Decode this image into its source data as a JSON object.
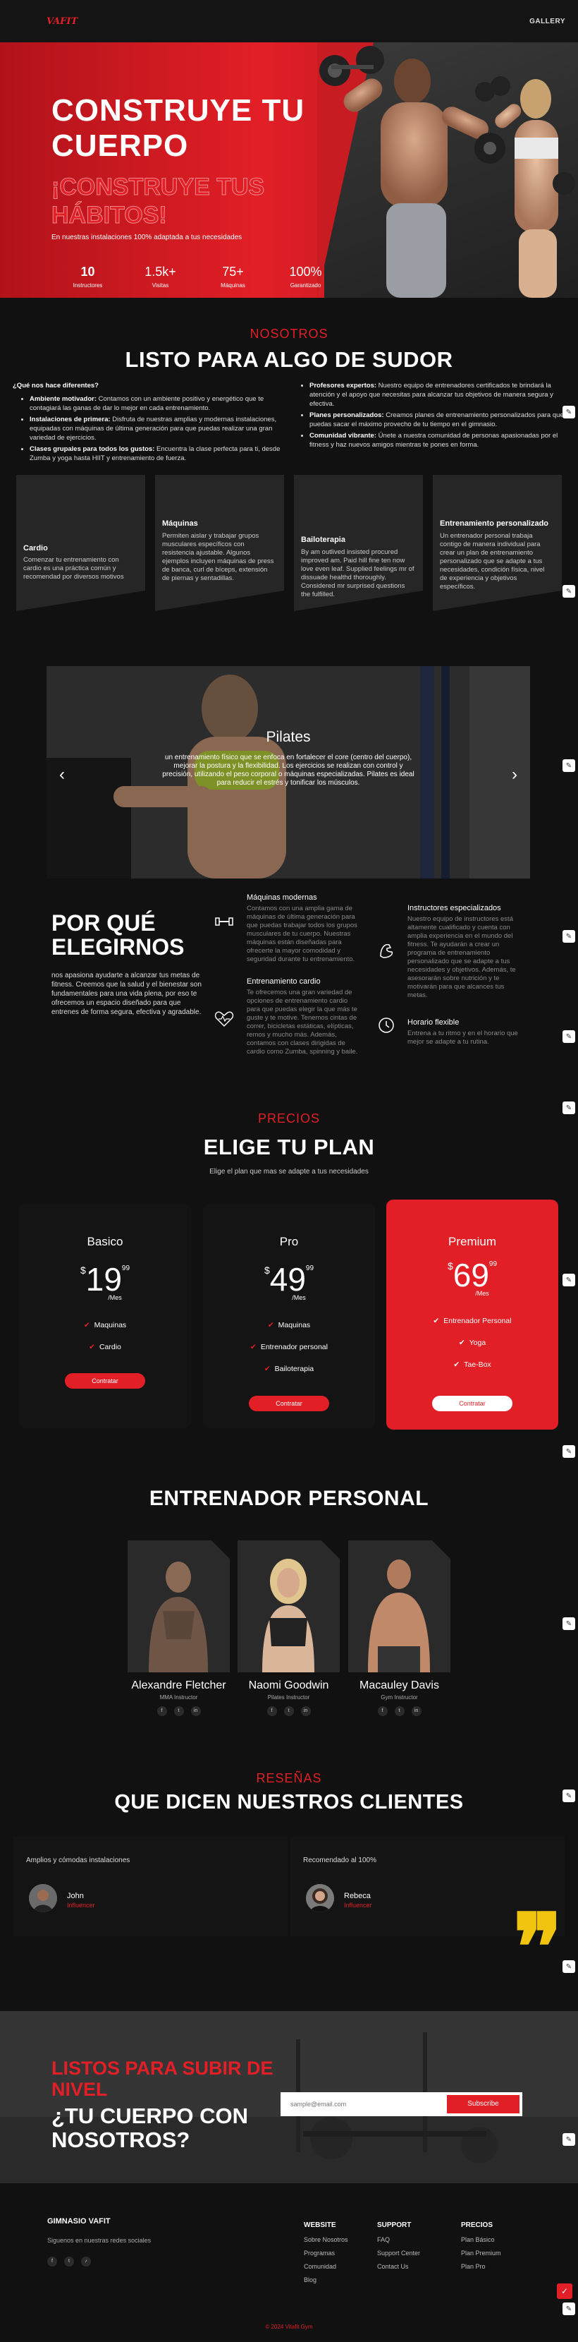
{
  "header": {
    "logo": "VAFIT",
    "nav_gallery": "GALLERY"
  },
  "hero": {
    "title": "CONSTRUYE TU CUERPO",
    "subtitle": "¡CONSTRUYE TUS HÁBITOS!",
    "description": "En nuestras instalaciones 100% adaptada a tus necesidades",
    "stats": [
      {
        "value": "10",
        "label": "Instructores"
      },
      {
        "value": "1.5k+",
        "label": "Visitas"
      },
      {
        "value": "75+",
        "label": "Máquinas"
      },
      {
        "value": "100%",
        "label": "Garantizado"
      }
    ]
  },
  "about": {
    "kicker": "NOSOTROS",
    "heading": "LISTO PARA ALGO DE SUDOR",
    "question": "¿Qué nos hace diferentes?",
    "left_items": [
      {
        "bold": "Ambiente motivador:",
        "text": " Contamos con un ambiente positivo y energético que te contagiará las ganas de dar lo mejor en cada entrenamiento."
      },
      {
        "bold": "Instalaciones de primera:",
        "text": " Disfruta de nuestras amplias y modernas instalaciones, equipadas con máquinas de última generación para que puedas realizar una gran variedad de ejercicios."
      },
      {
        "bold": "Clases grupales para todos los gustos:",
        "text": " Encuentra la clase perfecta para ti, desde Zumba y yoga hasta HIIT y entrenamiento de fuerza."
      }
    ],
    "right_items": [
      {
        "bold": "Profesores expertos:",
        "text": " Nuestro equipo de entrenadores certificados te brindará la atención y el apoyo que necesitas para alcanzar tus objetivos de manera segura y efectiva."
      },
      {
        "bold": "Planes personalizados:",
        "text": " Creamos planes de entrenamiento personalizados para que puedas sacar el máximo provecho de tu tiempo en el gimnasio."
      },
      {
        "bold": "Comunidad vibrante:",
        "text": " Únete a nuestra comunidad de personas apasionadas por el fitness y haz nuevos amigos mientras te pones en forma."
      }
    ],
    "services": [
      {
        "title": "Cardio",
        "desc": "Comenzar tu entrenamiento con cardio es una práctica común y recomendad por diversos motivos"
      },
      {
        "title": "Máquinas",
        "desc": "Permiten aislar y trabajar grupos musculares específicos con resistencia ajustable. Algunos ejemplos incluyen máquinas de press de banca, curl de bíceps, extensión de piernas y sentadillas."
      },
      {
        "title": "Bailoterapia",
        "desc": "By am outlived insisted procured improved am. Paid hill fine ten now love even leaf. Supplied feelings mr of dissuade healthd thoroughly. Considered mr surprised questions the fulfilled."
      },
      {
        "title": "Entrenamiento personalizado",
        "desc": "Un entrenador personal trabaja contigo de manera individual para crear un plan de entrenamiento personalizado que se adapte a tus necesidades, condición física, nivel de experiencia y objetivos específicos."
      }
    ]
  },
  "slider": {
    "title": "Pilates",
    "desc": "un entrenamiento físico que se enfoca en fortalecer el core (centro del cuerpo), mejorar la postura y la flexibilidad. Los ejercicios se realizan con control y precisión, utilizando el peso corporal o máquinas especializadas. Pilates es ideal para reducir el estrés y tonificar los músculos."
  },
  "why": {
    "title": "POR QUÉ ELEGIRNOS",
    "desc": "nos apasiona ayudarte a alcanzar tus metas de fitness. Creemos que la salud y el bienestar son fundamentales para una vida plena, por eso te ofrecemos un espacio diseñado para que entrenes de forma segura, efectiva y agradable.",
    "features": [
      {
        "title": "Máquinas modernas",
        "desc": "Contamos con una amplia gama de máquinas de última generación para que puedas trabajar todos los grupos musculares de tu cuerpo. Nuestras máquinas están diseñadas para ofrecerte la mayor comodidad y seguridad durante tu entrenamiento."
      },
      {
        "title": "Instructores especializados",
        "desc": "Nuestro equipo de instructores está altamente cualificado y cuenta con amplia experiencia en el mundo del fitness. Te ayudarán a crear un programa de entrenamiento personalizado que se adapte a tus necesidades y objetivos. Además, te asesorarán sobre nutrición y te motivarán para que alcances tus metas."
      },
      {
        "title": "Entrenamiento cardio",
        "desc": "Te ofrecemos una gran variedad de opciones de entrenamiento cardio para que puedas elegir la que más te guste y te motive. Tenemos cintas de correr, bicicletas estáticas, elípticas, remos y mucho más. Además, contamos con clases dirigidas de cardio como Zumba, spinning y baile."
      },
      {
        "title": "Horario flexible",
        "desc": "Entrena a tu ritmo y en el horario que mejor se adapte a tu rutina."
      }
    ]
  },
  "pricing": {
    "kicker": "PRECIOS",
    "heading": "ELIGE TU PLAN",
    "sub": "Elige el plan que mas se adapte a tus necesidades",
    "plans": [
      {
        "name": "Basico",
        "currency": "$",
        "amount": "19",
        "cents": "99",
        "period": "/Mes",
        "features": [
          "Maquinas",
          "Cardio"
        ],
        "button": "Contratar"
      },
      {
        "name": "Pro",
        "currency": "$",
        "amount": "49",
        "cents": "99",
        "period": "/Mes",
        "features": [
          "Maquinas",
          "Entrenador personal",
          "Bailoterapia"
        ],
        "button": "Contratar"
      },
      {
        "name": "Premium",
        "currency": "$",
        "amount": "69",
        "cents": "99",
        "period": "/Mes",
        "features": [
          "Entrenador Personal",
          "Yoga",
          "Tae-Box"
        ],
        "button": "Contratar"
      }
    ]
  },
  "trainers": {
    "heading": "ENTRENADOR PERSONAL",
    "items": [
      {
        "name": "Alexandre Fletcher",
        "role": "MMA Instructor"
      },
      {
        "name": "Naomi Goodwin",
        "role": "Pilates Instructor"
      },
      {
        "name": "Macauley Davis",
        "role": "Gym Instructor"
      }
    ],
    "social": [
      "f",
      "t",
      "in"
    ]
  },
  "reviews": {
    "kicker": "RESEÑAS",
    "heading": "QUE DICEN NUESTROS CLIENTES",
    "items": [
      {
        "quote": "Amplios y cómodas instalaciones",
        "name": "John",
        "role": "Influencer"
      },
      {
        "quote": "Recomendado al 100%",
        "name": "Rebeca",
        "role": "Influencer"
      }
    ],
    "quote_mark": "❞"
  },
  "cta": {
    "line1": "LISTOS PARA SUBIR DE NIVEL",
    "line2": "¿TU CUERPO CON NOSOTROS?",
    "email_placeholder": "sample@email.com",
    "button": "Subscribe"
  },
  "footer": {
    "brand": "GIMNASIO VAFIT",
    "tagline": "Siguenos en nuestras redes sociales",
    "social": [
      "f",
      "t",
      "♪"
    ],
    "columns": [
      {
        "heading": "WEBSITE",
        "links": [
          "Sobre Nosotros",
          "Programas",
          "Comunidad",
          "Blog"
        ]
      },
      {
        "heading": "SUPPORT",
        "links": [
          "FAQ",
          "Support Center",
          "Contact Us"
        ]
      },
      {
        "heading": "PRECIOS",
        "links": [
          "Plan Básico",
          "Plan Premium",
          "Plan Pro"
        ]
      }
    ],
    "copyright": "© 2024 Vitafit Gym"
  },
  "colors": {
    "accent": "#e21f26",
    "background": "#111111",
    "card": "#141414",
    "quote": "#f1c40f"
  },
  "icons": {
    "edit": "edit-icon",
    "check": "check-icon"
  }
}
